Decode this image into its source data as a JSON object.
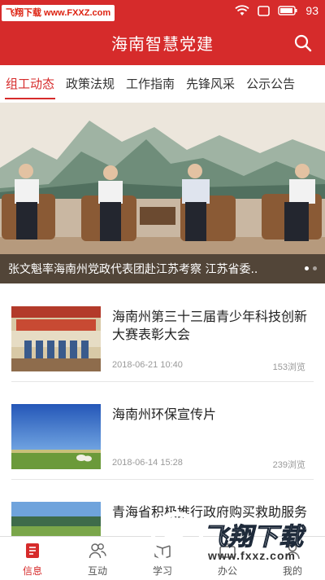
{
  "watermark": {
    "text": "飞翔下载 www.FXXZ.com"
  },
  "status_bar": {
    "battery": "93",
    "icons": [
      "wifi-icon",
      "window-icon",
      "battery-icon"
    ]
  },
  "header": {
    "title": "海南智慧党建",
    "search_icon": "search-icon"
  },
  "tabs": [
    {
      "label": "组工动态",
      "active": true
    },
    {
      "label": "政策法规"
    },
    {
      "label": "工作指南"
    },
    {
      "label": "先锋风采"
    },
    {
      "label": "公示公告"
    }
  ],
  "banner": {
    "caption": "张文魁率海南州党政代表团赴江苏考察 江苏省委..",
    "slide_count": 2,
    "current_slide": 1
  },
  "news": [
    {
      "title": "海南州第三十三届青少年科技创新大赛表彰大会",
      "date": "2018-06-21 10:40",
      "views": "153浏览"
    },
    {
      "title": "海南州环保宣传片",
      "date": "2018-06-14 15:28",
      "views": "239浏览"
    },
    {
      "title": "青海省积极推行政府购买救助服务",
      "date": "",
      "views": ""
    }
  ],
  "bottom_nav": [
    {
      "label": "信息",
      "icon": "info-document-icon",
      "active": true
    },
    {
      "label": "互动",
      "icon": "people-icon"
    },
    {
      "label": "学习",
      "icon": "study-icon"
    },
    {
      "label": "办公",
      "icon": "office-icon"
    },
    {
      "label": "我的",
      "icon": "profile-icon"
    }
  ],
  "overlay_logo": {
    "name": "飞翔下载",
    "url": "www.fxxz.com"
  },
  "colors": {
    "brand": "#d62b2b",
    "text": "#222222",
    "muted": "#999999"
  }
}
